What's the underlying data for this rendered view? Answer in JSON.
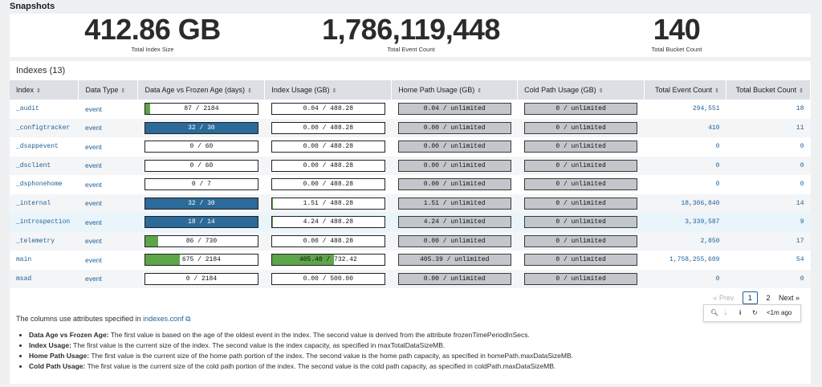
{
  "section_title": "Snapshots",
  "kpis": [
    {
      "value": "412.86 GB",
      "label": "Total Index Size"
    },
    {
      "value": "1,786,119,448",
      "label": "Total Event Count"
    },
    {
      "value": "140",
      "label": "Total Bucket Count"
    }
  ],
  "indexes_title": "Indexes (13)",
  "columns": [
    "Index",
    "Data Type",
    "Data Age vs Frozen Age (days)",
    "Index Usage (GB)",
    "Home Path Usage (GB)",
    "Cold Path Usage (GB)",
    "Total Event Count",
    "Total Bucket Count"
  ],
  "rows": [
    {
      "index": "_audit",
      "type": "event",
      "age": "87 / 2184",
      "age_frac": 0.04,
      "usage": "0.04 / 488.28",
      "usage_frac": 0.0,
      "home": "0.04 / unlimited",
      "cold": "0 / unlimited",
      "events": "294,551",
      "buckets": "18"
    },
    {
      "index": "_configtracker",
      "type": "event",
      "age": "32 / 30",
      "age_frac": 1.0,
      "usage": "0.00 / 488.28",
      "usage_frac": 0.0,
      "home": "0.00 / unlimited",
      "cold": "0 / unlimited",
      "events": "410",
      "buckets": "11"
    },
    {
      "index": "_dsappevent",
      "type": "event",
      "age": "0 / 60",
      "age_frac": 0.0,
      "usage": "0.00 / 488.28",
      "usage_frac": 0.0,
      "home": "0.00 / unlimited",
      "cold": "0 / unlimited",
      "events": "0",
      "buckets": "0"
    },
    {
      "index": "_dsclient",
      "type": "event",
      "age": "0 / 60",
      "age_frac": 0.0,
      "usage": "0.00 / 488.28",
      "usage_frac": 0.0,
      "home": "0.00 / unlimited",
      "cold": "0 / unlimited",
      "events": "0",
      "buckets": "0"
    },
    {
      "index": "_dsphonehome",
      "type": "event",
      "age": "0 / 7",
      "age_frac": 0.0,
      "usage": "0.00 / 488.28",
      "usage_frac": 0.0,
      "home": "0.00 / unlimited",
      "cold": "0 / unlimited",
      "events": "0",
      "buckets": "0"
    },
    {
      "index": "_internal",
      "type": "event",
      "age": "32 / 30",
      "age_frac": 1.0,
      "usage": "1.51 / 488.28",
      "usage_frac": 0.003,
      "home": "1.51 / unlimited",
      "cold": "0 / unlimited",
      "events": "18,306,840",
      "buckets": "14"
    },
    {
      "index": "_introspection",
      "type": "event",
      "age": "18 / 14",
      "age_frac": 1.0,
      "usage": "4.24 / 488.28",
      "usage_frac": 0.009,
      "home": "4.24 / unlimited",
      "cold": "0 / unlimited",
      "events": "3,339,587",
      "buckets": "9"
    },
    {
      "index": "_telemetry",
      "type": "event",
      "age": "86 / 730",
      "age_frac": 0.118,
      "usage": "0.00 / 488.28",
      "usage_frac": 0.0,
      "home": "0.00 / unlimited",
      "cold": "0 / unlimited",
      "events": "2,850",
      "buckets": "17"
    },
    {
      "index": "main",
      "type": "event",
      "age": "675 / 2184",
      "age_frac": 0.309,
      "usage": "405.40 / 732.42",
      "usage_frac": 0.553,
      "home": "405.39 / unlimited",
      "cold": "0 / unlimited",
      "events": "1,758,255,609",
      "buckets": "54"
    },
    {
      "index": "msad",
      "type": "event",
      "age": "0 / 2184",
      "age_frac": 0.0,
      "usage": "0.00 / 500.00",
      "usage_frac": 0.0,
      "home": "0.00 / unlimited",
      "cold": "0 / unlimited",
      "events": "0",
      "buckets": "0"
    }
  ],
  "pager": {
    "prev": "« Prev",
    "page1": "1",
    "page2": "2",
    "next": "Next »"
  },
  "toolbar": {
    "refresh_time": "<1m ago"
  },
  "note": {
    "text": "The columns use attributes specified in",
    "link": "indexes.conf"
  },
  "descriptions": [
    {
      "term": "Data Age vs Frozen Age:",
      "text": "The first value is based on the age of the oldest event in the index. The second value is derived from the attribute frozenTimePeriodInSecs."
    },
    {
      "term": "Index Usage:",
      "text": "The first value is the current size of the index. The second value is the index capacity, as specified in maxTotalDataSizeMB."
    },
    {
      "term": "Home Path Usage:",
      "text": "The first value is the current size of the home path portion of the index. The second value is the home path capacity, as specified in homePath.maxDataSizeMB."
    },
    {
      "term": "Cold Path Usage:",
      "text": "The first value is the current size of the cold path portion of the index. The second value is the cold path capacity, as specified in coldPath.maxDataSizeMB."
    }
  ],
  "colors": {
    "green": "#5ea54a",
    "blue": "#2b6a99",
    "grey": "#c3c7cc",
    "link": "#1e5f96"
  }
}
